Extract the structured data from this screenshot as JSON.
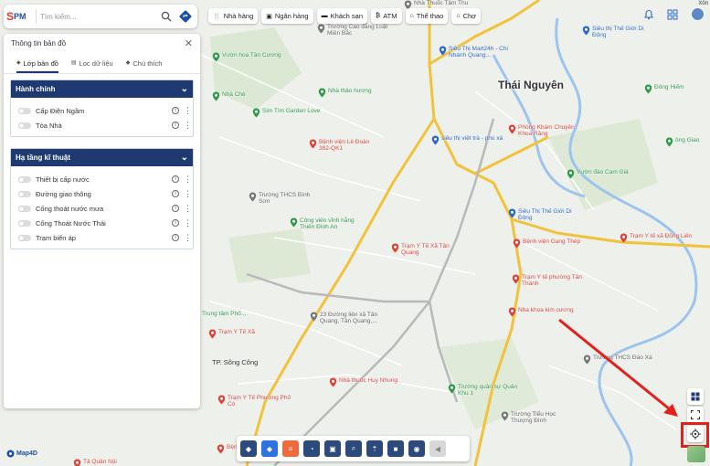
{
  "search": {
    "placeholder": "Tìm kiếm..."
  },
  "logo": {
    "s": "S",
    "pm": "PM"
  },
  "chips": [
    {
      "icon": "restaurant-icon",
      "glyph": "🍴",
      "label": "Nhà hàng"
    },
    {
      "icon": "bank-icon",
      "glyph": "▣",
      "label": "Ngân hàng"
    },
    {
      "icon": "hotel-icon",
      "glyph": "▬",
      "label": "Khách sạn"
    },
    {
      "icon": "atm-icon",
      "glyph": "₿",
      "label": "ATM"
    },
    {
      "icon": "sport-icon",
      "glyph": "⌂",
      "label": "Thể thao"
    },
    {
      "icon": "market-icon",
      "glyph": "⌂",
      "label": "Chợ"
    }
  ],
  "user": {
    "name": "Xôn"
  },
  "panel": {
    "title": "Thông tin bản đồ",
    "tabs": [
      {
        "label": "Lớp bản đồ",
        "icon": "layers-icon"
      },
      {
        "label": "Lọc dữ liệu",
        "icon": "filter-icon"
      },
      {
        "label": "Chú thích",
        "icon": "legend-icon"
      }
    ],
    "groups": [
      {
        "title": "Hành chính",
        "items": [
          "Cấp Điện Ngầm",
          "Tòa Nhà"
        ]
      },
      {
        "title": "Hạ tầng kĩ thuật",
        "items": [
          "Thiết bị cấp nước",
          "Đường giao thông",
          "Cống thoát nước mưa",
          "Cống Thoát Nước Thải",
          "Trạm biến áp"
        ]
      }
    ]
  },
  "map": {
    "city": "Thái Nguyên",
    "town": "TP. Sông Công",
    "pois": [
      {
        "type": "gray",
        "text": "Nhà Thuốc Tâm Thu"
      },
      {
        "type": "gray",
        "text": "Trường Cao đẳng Luật Miền Bắc"
      },
      {
        "type": "green",
        "text": "Vườn hoa Tân Cương"
      },
      {
        "type": "blue",
        "text": "Siêu Thị Mart24h - Chi Nhánh Quang..."
      },
      {
        "type": "blue",
        "text": "Siêu thị Thế Giới Di Động"
      },
      {
        "type": "green",
        "text": "Nhà Chè"
      },
      {
        "type": "green",
        "text": "Nhà thảo hương"
      },
      {
        "type": "green",
        "text": "Đông Hiếm"
      },
      {
        "type": "green",
        "text": "Sim Tìm Garden Love"
      },
      {
        "type": "red",
        "text": "Bệnh viện Lê Đoàn 382-QK1"
      },
      {
        "type": "red",
        "text": "Phòng Khám Chuyên Khoa Răng"
      },
      {
        "type": "blue",
        "text": "siêu thị việt trà - phú xá"
      },
      {
        "type": "green",
        "text": "Vườn đào Cam Giá"
      },
      {
        "type": "green",
        "text": "ông Giao"
      },
      {
        "type": "gray",
        "text": "Trường THCS Bình Sơn"
      },
      {
        "type": "blue",
        "text": "Siêu Thị Thế Giới Di Động"
      },
      {
        "type": "green",
        "text": "Công viên vĩnh hằng Thiên Đình An"
      },
      {
        "type": "red",
        "text": "Bệnh viện Gang Thép"
      },
      {
        "type": "red",
        "text": "Trạm Y tế xã Đồng Liên"
      },
      {
        "type": "red",
        "text": "Trạm Y Tế Xã Tân Quang"
      },
      {
        "type": "red",
        "text": "Trạm Y tế phường Tân Thành"
      },
      {
        "type": "red",
        "text": "Nha khoa kim cương"
      },
      {
        "type": "gray",
        "text": "23 Đường liên xã Tân Quang, Tân Quang,..."
      },
      {
        "type": "green",
        "text": "Trung tâm Phố..."
      },
      {
        "type": "red",
        "text": "Nhà thuốc Huy Nhung"
      },
      {
        "type": "green",
        "text": "Trường quân sự Quân Khu 1"
      },
      {
        "type": "gray",
        "text": "Trường THCS Đào Xá"
      },
      {
        "type": "red",
        "text": "Trạm Y Tế Phường Phố Cò"
      },
      {
        "type": "gray",
        "text": "Trường Tiểu Học Thượng Đình"
      },
      {
        "type": "red",
        "text": "Bệnh viện C"
      },
      {
        "type": "red",
        "text": "Trạm Y Tế Xã"
      },
      {
        "type": "red",
        "text": "Tả Quân Nội"
      }
    ]
  },
  "toolbar": [
    {
      "icon": "layers-icon",
      "glyph": "◆",
      "style": ""
    },
    {
      "icon": "diamond-icon",
      "glyph": "◆",
      "style": "blue"
    },
    {
      "icon": "list-icon",
      "glyph": "≡",
      "style": "orange"
    },
    {
      "icon": "clock-icon",
      "glyph": "◔",
      "style": ""
    },
    {
      "icon": "image-icon",
      "glyph": "▣",
      "style": ""
    },
    {
      "icon": "search-icon",
      "glyph": "⌕",
      "style": ""
    },
    {
      "icon": "upload-icon",
      "glyph": "⇡",
      "style": ""
    },
    {
      "icon": "square-icon",
      "glyph": "■",
      "style": ""
    },
    {
      "icon": "eye-icon",
      "glyph": "◉",
      "style": ""
    },
    {
      "icon": "collapse-left-icon",
      "glyph": "◀",
      "style": "light"
    }
  ],
  "map4d": "Map4D"
}
